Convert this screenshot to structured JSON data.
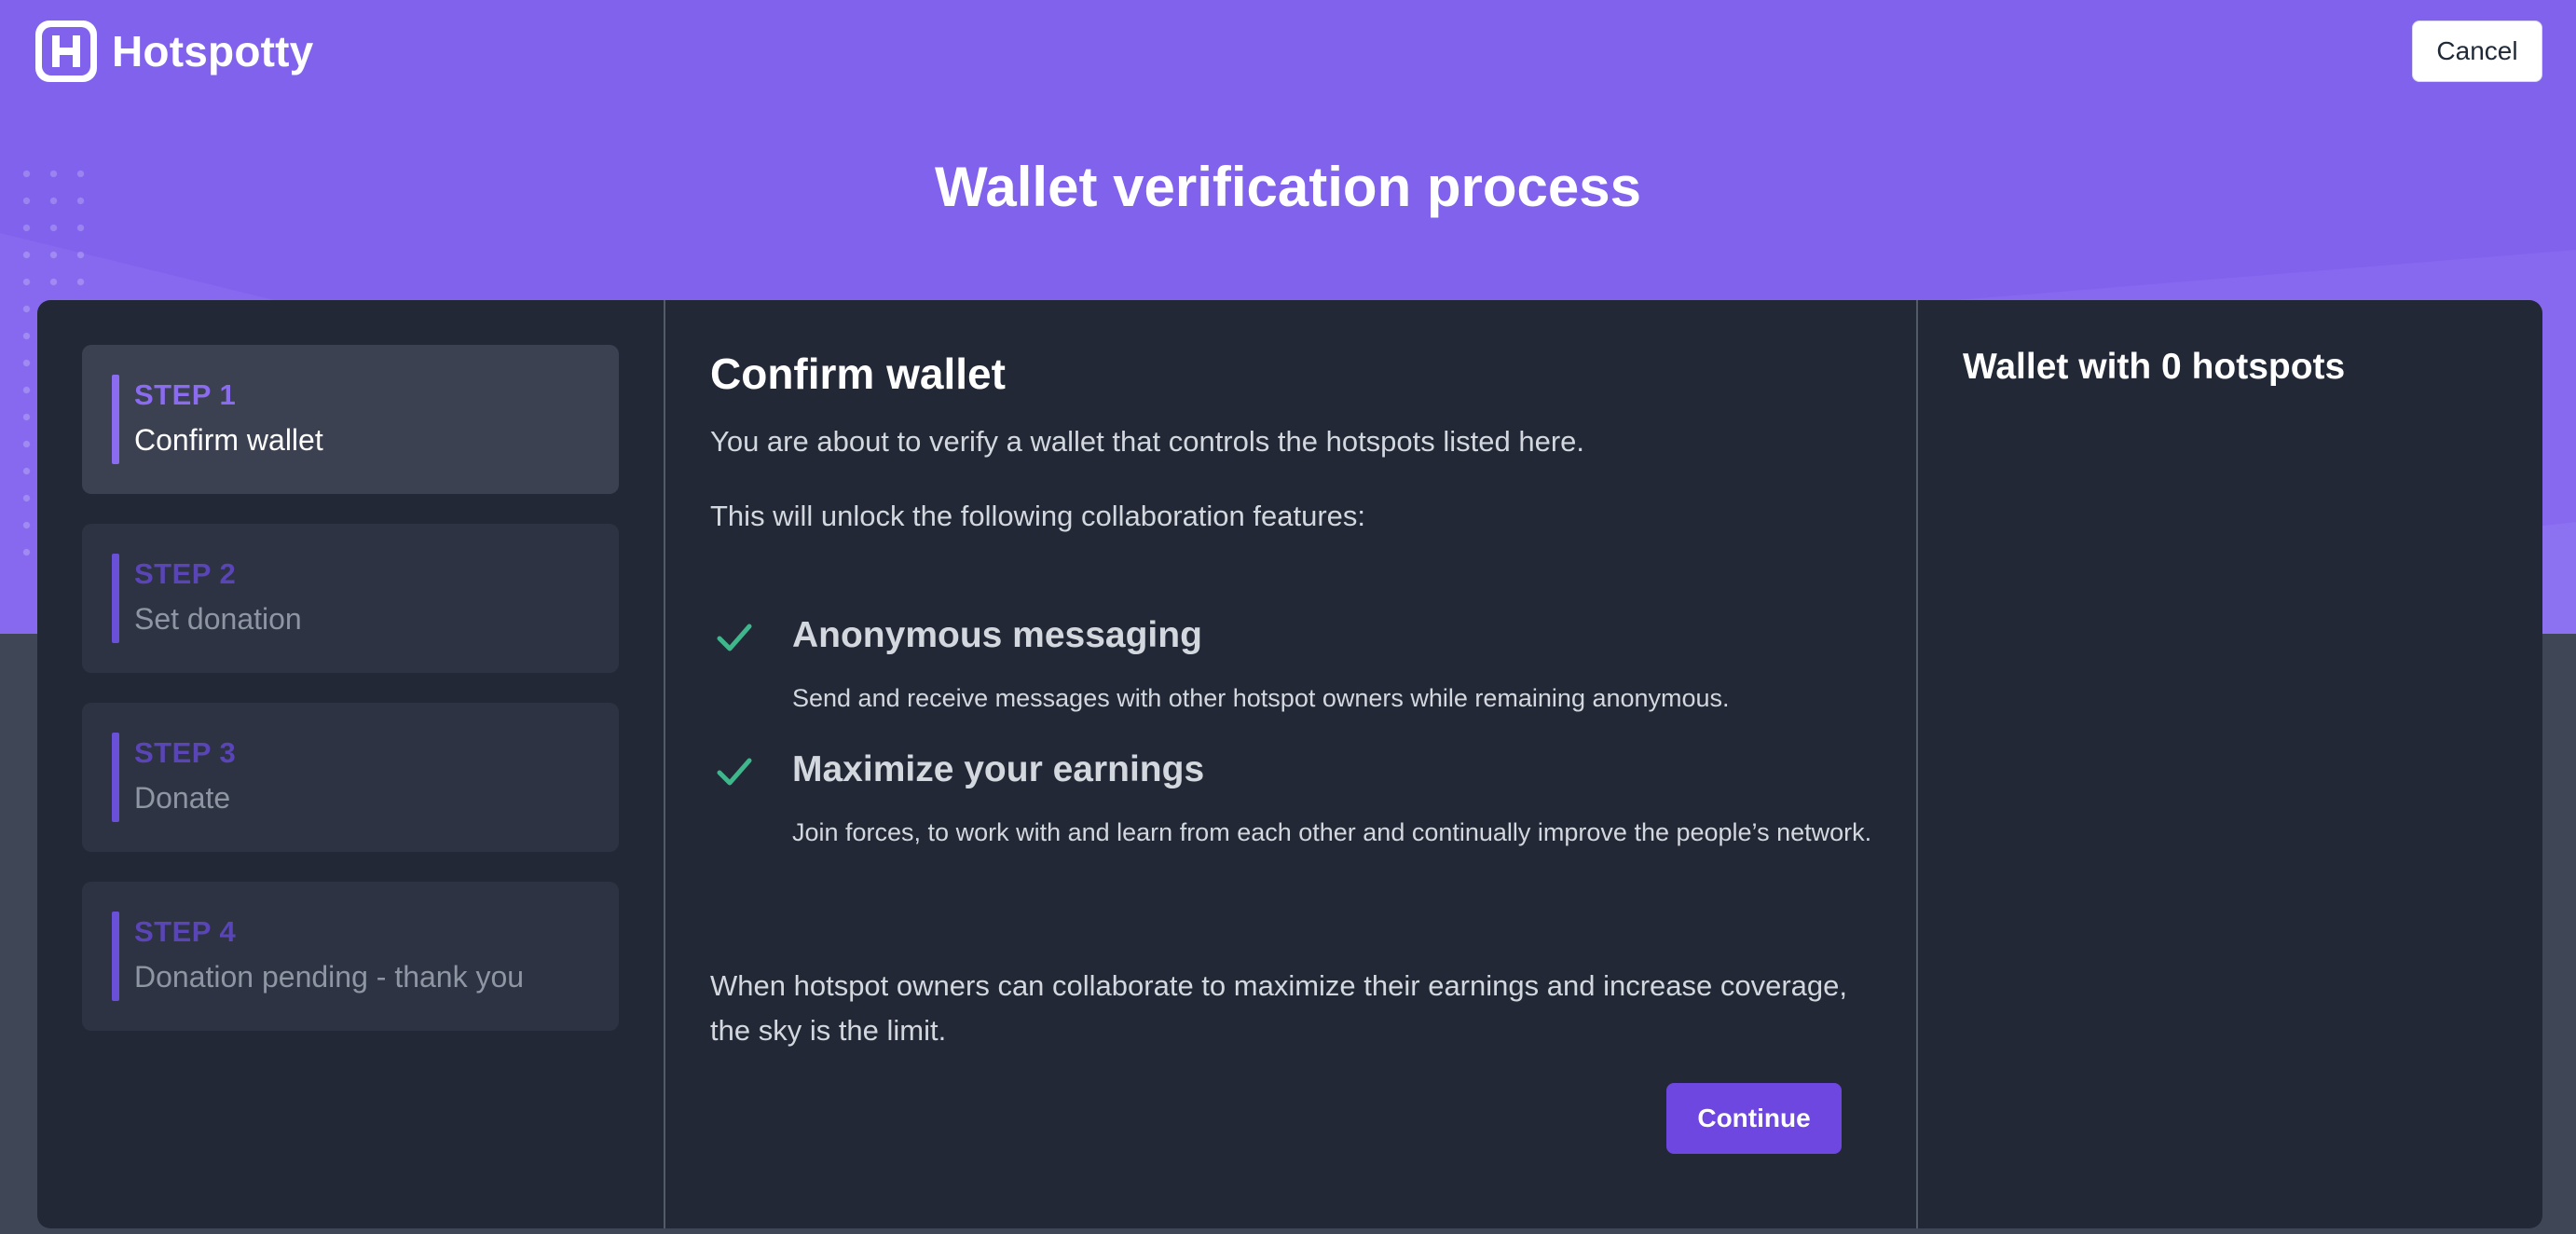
{
  "header": {
    "brand": "Hotspotty",
    "cancel_label": "Cancel",
    "title": "Wallet verification process"
  },
  "steps": [
    {
      "number": "STEP 1",
      "label": "Confirm wallet",
      "state": "active"
    },
    {
      "number": "STEP 2",
      "label": "Set donation",
      "state": "inactive"
    },
    {
      "number": "STEP 3",
      "label": "Donate",
      "state": "inactive"
    },
    {
      "number": "STEP 4",
      "label": "Donation pending - thank you",
      "state": "inactive"
    }
  ],
  "main": {
    "heading": "Confirm wallet",
    "intro": "You are about to verify a wallet that controls the hotspots listed here.",
    "unlock_text": "This will unlock the following collaboration features:",
    "features": [
      {
        "icon": "check-icon",
        "title": "Anonymous messaging",
        "description": "Send and receive messages with other hotspot owners while remaining anonymous."
      },
      {
        "icon": "check-icon",
        "title": "Maximize your earnings",
        "description": "Join forces, to work with and learn from each other and continually improve the people’s network."
      }
    ],
    "closing": "When hotspot owners can collaborate to maximize their earnings and increase coverage, the sky is the limit.",
    "continue_label": "Continue"
  },
  "sidebar": {
    "heading": "Wallet with 0 hotspots"
  },
  "colors": {
    "brand_purple": "#8062ec",
    "card_bg": "#222836",
    "accent_button": "#6e46e0",
    "check_green": "#3fb68b"
  }
}
